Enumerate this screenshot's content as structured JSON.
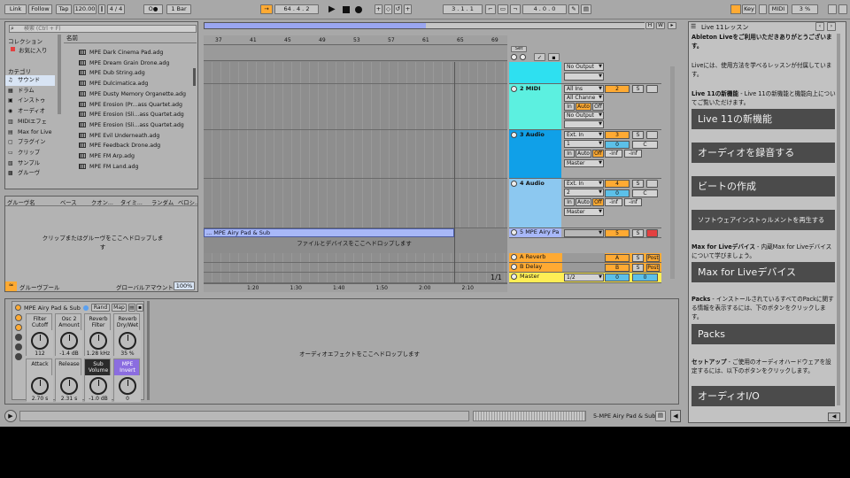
{
  "topbar": {
    "link": "Link",
    "follow": "Follow",
    "tap": "Tap",
    "tempo": "120.00",
    "sig": "4 / 4",
    "metro": "O●",
    "quant": "1 Bar",
    "pos": "64 .   4 .   2",
    "loop_start": "3 .   1 .   1",
    "loop_len": "4 .   0 .   0",
    "key": "Key",
    "midi": "MIDI",
    "cpu": "3 %"
  },
  "browser": {
    "search_placeholder": "検索 (Ctrl + F)",
    "col_header": "名前",
    "collections_label": "コレクション",
    "favorites": "お気に入り",
    "categories_label": "カテゴリ",
    "categories": [
      "サウンド",
      "ドラム",
      "インストゥ",
      "オーディオ",
      "MIDIエフェ",
      "Max for Live",
      "プラグイン",
      "クリップ",
      "サンプル",
      "グルーヴ"
    ],
    "files": [
      "MPE Dark Cinema Pad.adg",
      "MPE Dream Grain Drone.adg",
      "MPE Dub String.adg",
      "MPE Dulcimatica.adg",
      "MPE Dusty Memory Organette.adg",
      "MPE Erosion (Pr...ass Quartet.adg",
      "MPE Erosion (Sli...ass Quartet.adg",
      "MPE Erosion (Sli...ass Quartet.adg",
      "MPE Evil Underneath.adg",
      "MPE Feedback Drone.adg",
      "MPE FM Arp.adg",
      "MPE FM Land.adg"
    ]
  },
  "groove": {
    "headers": [
      "グルーヴ名",
      "ベース",
      "クオン...",
      "タイミ...",
      "ランダム",
      "ベロシ..."
    ],
    "drop_hint": "クリップまたはグルーヴをここへドロップします",
    "pool_label": "グルーヴプール",
    "global_amount_label": "グローバルアマウント",
    "global_amount": "100%"
  },
  "arrangement": {
    "bars": [
      "37",
      "41",
      "45",
      "49",
      "53",
      "57",
      "61",
      "65",
      "69"
    ],
    "times": [
      "1:20",
      "1:30",
      "1:40",
      "1:50",
      "2:00",
      "2:10"
    ],
    "clip_name": "... MPE Airy Pad & Sub",
    "drop_hint": "ファイルとデバイスをここへドロップします",
    "page": "1/1",
    "set_label": "Set"
  },
  "tracks": [
    {
      "name": "",
      "color": "#2ee0f0",
      "in": "No Output",
      "num": ""
    },
    {
      "name": "2 MIDI",
      "color": "#5cf0e0",
      "in": "All Ins",
      "ch": "All Channe",
      "out": "No Output",
      "num": "2",
      "monitor": [
        "In",
        "Auto",
        "Off"
      ]
    },
    {
      "name": "3 Audio",
      "color": "#10a0e8",
      "in": "Ext. In",
      "ch": "1",
      "out": "Master",
      "num": "3",
      "monitor": [
        "In",
        "Auto",
        "Off"
      ],
      "vol": "-inf",
      "pan": "C"
    },
    {
      "name": "4 Audio",
      "color": "#8cc8f0",
      "in": "Ext. In",
      "ch": "2",
      "out": "Master",
      "num": "4",
      "monitor": [
        "In",
        "Auto",
        "Off"
      ],
      "vol": "-inf",
      "pan": "C"
    },
    {
      "name": "5 MPE Airy Pa",
      "color": "#a8b8f8",
      "num": "5"
    }
  ],
  "returns": [
    {
      "name": "A Reverb",
      "num": "A",
      "post": "Post"
    },
    {
      "name": "B Delay",
      "num": "B",
      "post": "Post"
    },
    {
      "name": "Master",
      "num": "0",
      "ratio": "1/2"
    }
  ],
  "device": {
    "title": "MPE Airy Pad & Sub",
    "rand": "Rand",
    "map": "Map",
    "params": [
      {
        "label": "Filter Cutoff",
        "value": "112"
      },
      {
        "label": "Osc 2 Amount",
        "value": "-1.4 dB"
      },
      {
        "label": "Reverb Filter",
        "value": "1.28 kHz"
      },
      {
        "label": "Reverb Dry/Wet",
        "value": "35 %"
      },
      {
        "label": "Attack",
        "value": "2.70 s"
      },
      {
        "label": "Release",
        "value": "2.31 s"
      },
      {
        "label": "Sub Volume",
        "value": "-1.0 dB"
      },
      {
        "label": "MPE Invert",
        "value": "0"
      }
    ],
    "drop_hint": "オーディオエフェクトをここへドロップします"
  },
  "statusbar": {
    "track": "5-MPE Airy Pad & Sub"
  },
  "lesson": {
    "title": "Live 11レッスン",
    "intro1": "Ableton Liveをご利用いただきありがとうございます。",
    "intro2": "Liveには、使用方法を学べるレッスンが付属しています。",
    "new_b": "Live 11の新機能",
    "new_t": " - Live 11の新機能と機能向上についてご覧いただけます。",
    "buttons": [
      "Live 11の新機能",
      "オーディオを録音する",
      "ビートの作成",
      "ソフトウェアインストゥルメントを再生する",
      "Max for Liveデバイス",
      "Packs",
      "オーディオI/O"
    ],
    "mfl_b": "Max for Liveデバイス",
    "mfl_t": " - 内蔵Max for Liveデバイスについて学びましょう。",
    "packs_b": "Packs",
    "packs_t": " - インストールされているすべてのPackに関する情報を表示するには、下のボタンをクリックします。",
    "setup_b": "セットアップ",
    "setup_t": " - ご使用のオーディオハードウェアを設定するには、以下のボタンをクリックします。"
  },
  "colors": {
    "accent": "#ffaa33",
    "device_purple": "#8b6de0",
    "selected_cat": "#d8e4f4"
  }
}
